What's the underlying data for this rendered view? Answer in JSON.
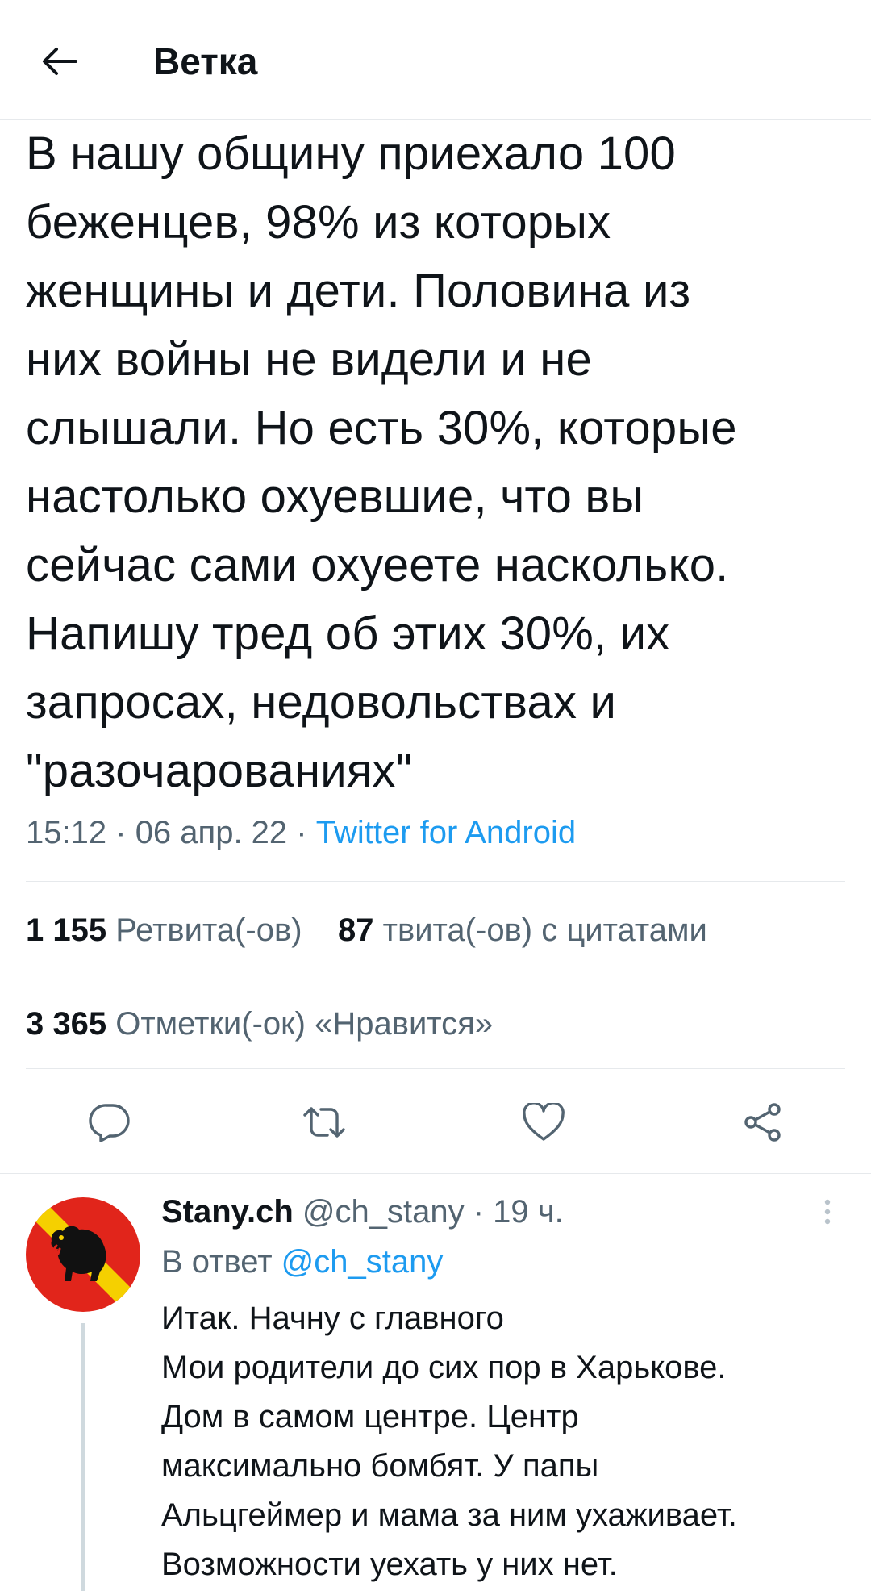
{
  "header": {
    "title": "Ветка",
    "back_icon": "arrow-left-icon"
  },
  "tweet": {
    "text": "В нашу общину приехало 100\nбеженцев, 98% из которых\nженщины и дети. Половина из\nних войны не видели и не\nслышали. Но есть 30%, которые\nнастолько охуевшие, что вы\nсейчас сами охуеете насколько.\nНапишу тред об этих 30%, их\nзапросах, недовольствах и\n\"разочарованиях\"",
    "time": "15:12",
    "date": "06 апр. 22",
    "sep": "·",
    "source": "Twitter for Android"
  },
  "stats": {
    "retweets_count": "1 155",
    "retweets_label": "Ретвита(-ов)",
    "quotes_count": "87",
    "quotes_label": "твита(-ов) с цитатами",
    "likes_count": "3 365",
    "likes_label": "Отметки(-ок) «Нравится»"
  },
  "actions": {
    "icons": [
      "reply-icon",
      "retweet-icon",
      "like-icon",
      "share-icon"
    ]
  },
  "reply": {
    "name": "Stany.ch",
    "handle": "@ch_stany",
    "sep": "·",
    "time": "19 ч.",
    "reply_prefix": "В ответ",
    "reply_handle": "@ch_stany",
    "text": "Итак. Начну с главного\nМои родители до сих пор в Харькове.\nДом в самом центре. Центр\nмаксимально бомбят. У папы\nАльцгеймер и мама за ним ухаживает.\nВозможности уехать у них нет."
  },
  "colors": {
    "accent": "#1d9bf0",
    "text": "#0f1419",
    "secondary": "#536471",
    "divider": "#e6e9ec",
    "avatar_red": "#e1251b",
    "avatar_yellow": "#f5d000"
  }
}
